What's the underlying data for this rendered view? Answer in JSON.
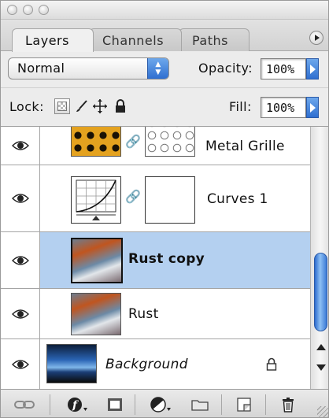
{
  "tabs": [
    {
      "label": "Layers",
      "active": true
    },
    {
      "label": "Channels",
      "active": false
    },
    {
      "label": "Paths",
      "active": false
    }
  ],
  "blend_mode": {
    "value": "Normal"
  },
  "opacity": {
    "label": "Opacity:",
    "value": "100%"
  },
  "lock": {
    "label": "Lock:",
    "icons": [
      "lock-transparent-icon",
      "lock-image-icon",
      "lock-position-icon",
      "lock-all-icon"
    ]
  },
  "fill": {
    "label": "Fill:",
    "value": "100%"
  },
  "layers": [
    {
      "name": "Metal Grille",
      "visible": true,
      "selected": false,
      "linked_mask": true,
      "bold": false,
      "italic": false
    },
    {
      "name": "Curves 1",
      "visible": true,
      "selected": false,
      "linked_mask": true,
      "bold": false,
      "italic": false
    },
    {
      "name": "Rust copy",
      "visible": true,
      "selected": true,
      "linked_mask": false,
      "bold": true,
      "italic": false
    },
    {
      "name": "Rust",
      "visible": true,
      "selected": false,
      "linked_mask": false,
      "bold": false,
      "italic": false
    },
    {
      "name": "Background",
      "visible": true,
      "selected": false,
      "linked_mask": false,
      "bold": false,
      "italic": true,
      "locked": true
    }
  ],
  "bottom_toolbar": [
    "link-layers-icon",
    "layer-style-icon",
    "add-mask-icon",
    "adjustment-layer-icon",
    "new-group-icon",
    "new-layer-icon",
    "trash-icon"
  ],
  "colors": {
    "selection": "#b4d0f0",
    "accent_blue": "#2f6fd0"
  }
}
